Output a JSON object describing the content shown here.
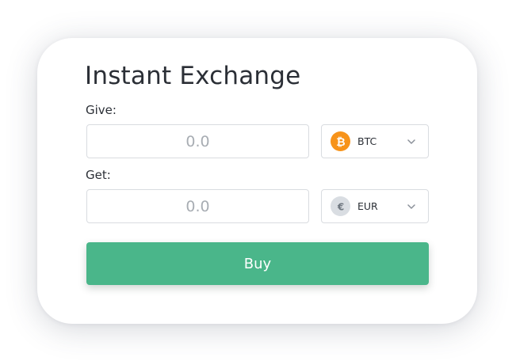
{
  "widget": {
    "title": "Instant Exchange",
    "give": {
      "label": "Give:",
      "amount_placeholder": "0.0",
      "currency": {
        "code": "BTC",
        "icon": "bitcoin-icon",
        "icon_color": "#f7931a"
      }
    },
    "get": {
      "label": "Get:",
      "amount_placeholder": "0.0",
      "currency": {
        "code": "EUR",
        "icon": "euro-icon",
        "icon_color": "#d9dde2"
      }
    },
    "buy_button": {
      "label": "Buy",
      "color": "#4ab68a"
    }
  }
}
